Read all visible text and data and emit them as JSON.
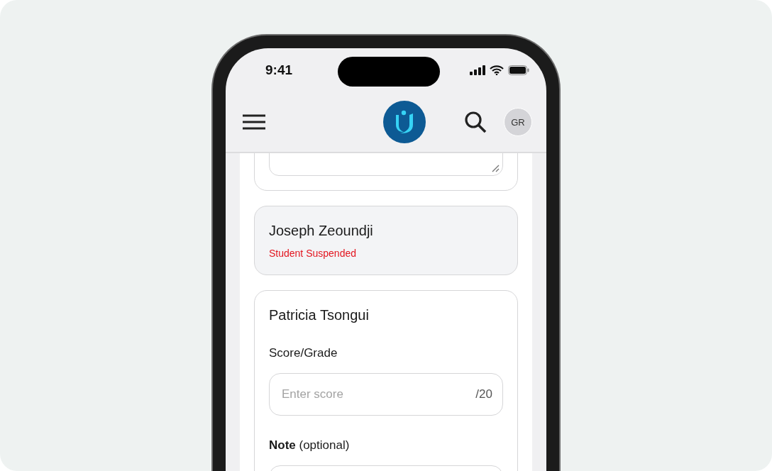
{
  "status_bar": {
    "time": "9:41"
  },
  "header": {
    "avatar": "GR"
  },
  "students": [
    {
      "kind": "partial"
    },
    {
      "kind": "suspended",
      "name": "Joseph Zeoundji",
      "status": "Student Suspended"
    },
    {
      "kind": "gradable",
      "name": "Patricia Tsongui",
      "score_label": "Score/Grade",
      "score_placeholder": "Enter score",
      "score_max": "/20",
      "note_label": "**Note** (optional)"
    }
  ]
}
